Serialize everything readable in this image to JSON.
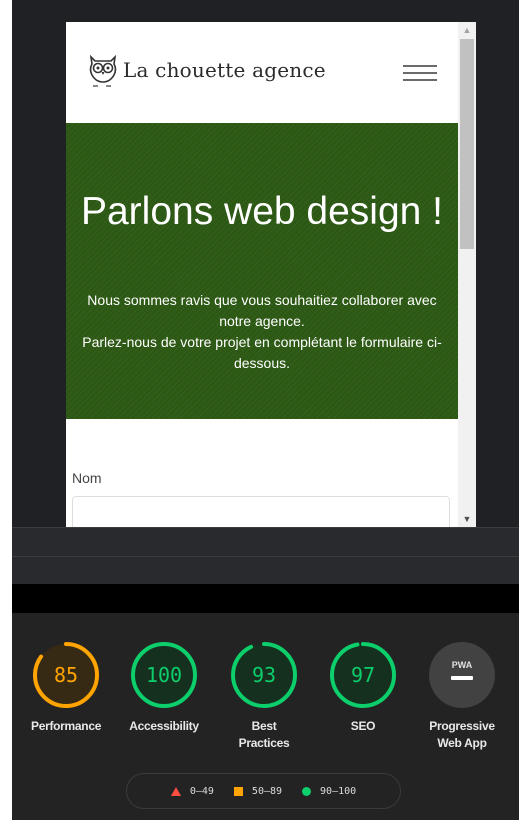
{
  "site": {
    "brand": "La chouette agence",
    "hero_title": "Parlons web design !",
    "hero_text_1": "Nous sommes ravis que vous souhaitiez collaborer avec notre agence.",
    "hero_text_2": "Parlez-nous de votre projet en complétant le formulaire ci-dessous.",
    "name_label": "Nom",
    "name_value": ""
  },
  "lighthouse": {
    "categories": [
      {
        "label": "Performance",
        "score": "85",
        "level": 0.85,
        "status": "average"
      },
      {
        "label": "Accessibility",
        "score": "100",
        "level": 1.0,
        "status": "pass"
      },
      {
        "label": "Best Practices",
        "score": "93",
        "level": 0.93,
        "status": "pass"
      },
      {
        "label": "SEO",
        "score": "97",
        "level": 0.97,
        "status": "pass"
      },
      {
        "label": "Progressive Web App",
        "badge": "PWA",
        "status": "na"
      }
    ],
    "legend": [
      {
        "range": "0–49",
        "icon": "triangle-icon",
        "color": "#ff4e42"
      },
      {
        "range": "50–89",
        "icon": "square-icon",
        "color": "#ffa400"
      },
      {
        "range": "90–100",
        "icon": "circle-icon",
        "color": "#0cce6b"
      }
    ]
  },
  "colors": {
    "average": "#ffa400",
    "pass": "#0cce6b",
    "fail": "#ff4e42",
    "hero_bg": "#2d5a14"
  }
}
